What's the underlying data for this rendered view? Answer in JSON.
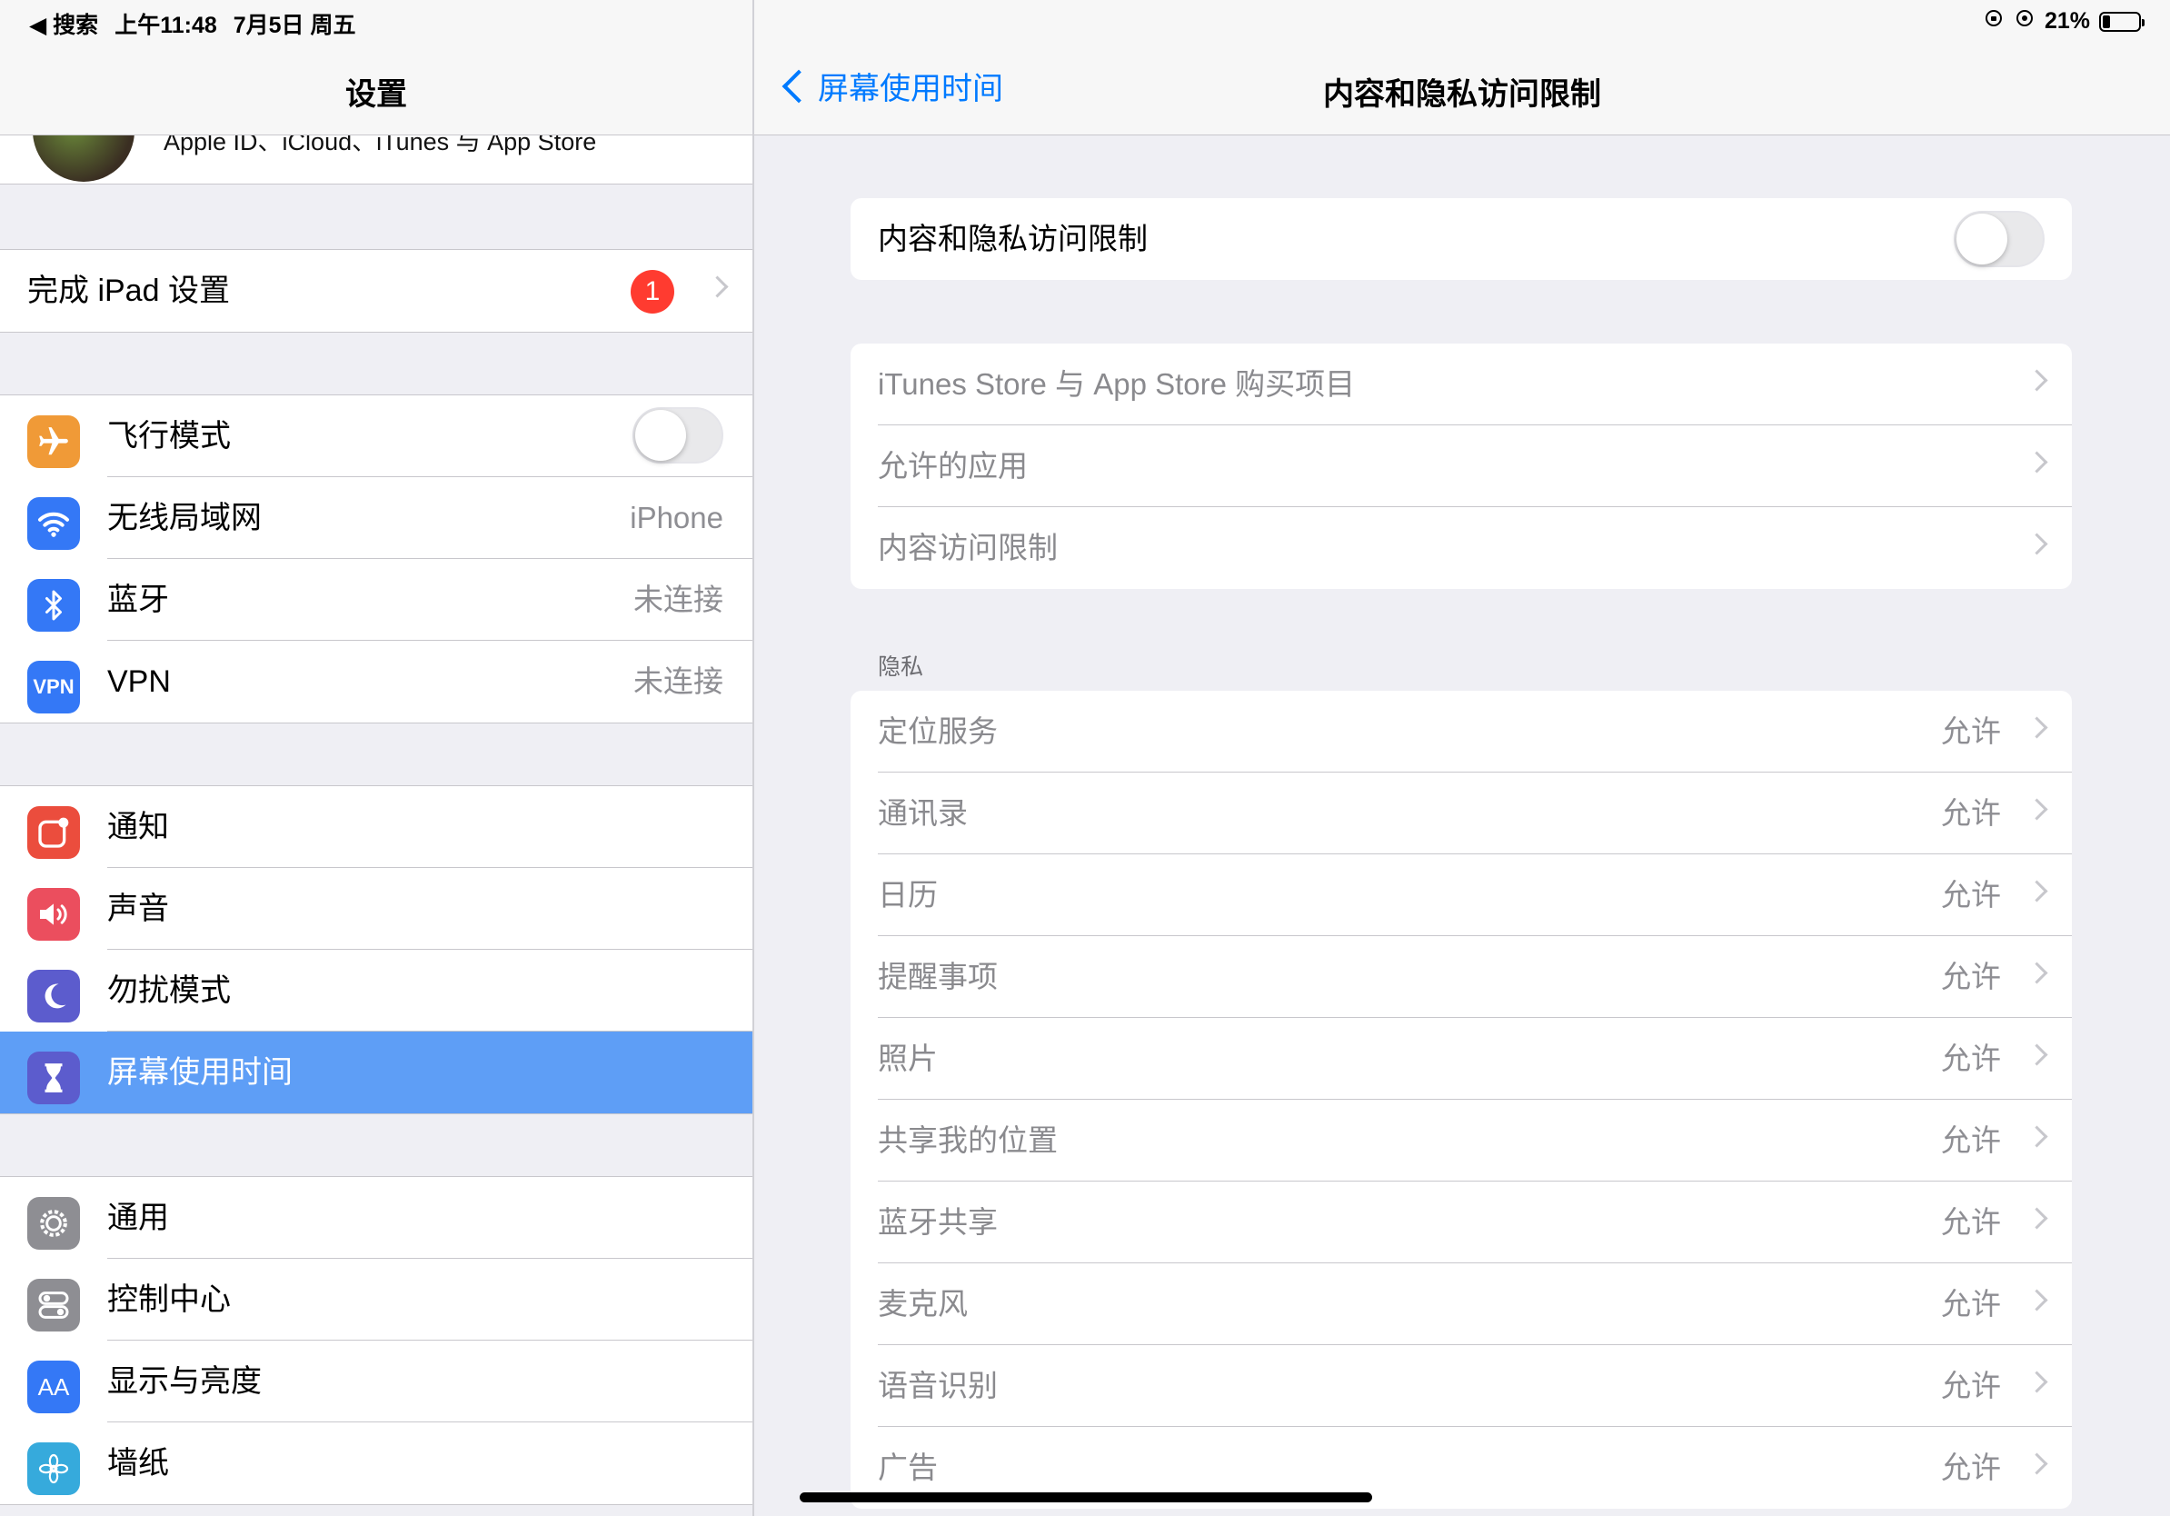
{
  "status_bar": {
    "back_app": "◀ 搜索",
    "time": "上午11:48",
    "date": "7月5日 周五",
    "icons": [
      "orientation-lock-icon",
      "screen-mirroring-icon"
    ],
    "battery_text": "21%",
    "battery_level": 0.21
  },
  "left": {
    "title": "设置",
    "profile_subtitle": "Apple ID、iCloud、iTunes 与 App Store",
    "setup": {
      "label": "完成 iPad 设置",
      "badge": "1"
    },
    "connectivity": [
      {
        "label": "飞行模式",
        "icon": "airplane-icon",
        "color": "#f09a37",
        "toggle": false
      },
      {
        "label": "无线局域网",
        "icon": "wifi-icon",
        "color": "#3478f6",
        "value": "iPhone"
      },
      {
        "label": "蓝牙",
        "icon": "bluetooth-icon",
        "color": "#3478f6",
        "value": "未连接"
      },
      {
        "label": "VPN",
        "icon": "vpn-icon",
        "color": "#3478f6",
        "value": "未连接",
        "icon_text": "VPN"
      }
    ],
    "alerts": [
      {
        "label": "通知",
        "icon": "notifications-icon",
        "color": "#eb4d3d"
      },
      {
        "label": "声音",
        "icon": "sound-icon",
        "color": "#eb4e5e"
      },
      {
        "label": "勿扰模式",
        "icon": "moon-icon",
        "color": "#5c5ccd"
      },
      {
        "label": "屏幕使用时间",
        "icon": "hourglass-icon",
        "color": "#5c5ccd",
        "selected": true
      }
    ],
    "general": [
      {
        "label": "通用",
        "icon": "gear-icon",
        "color": "#8e8e93"
      },
      {
        "label": "控制中心",
        "icon": "control-center-icon",
        "color": "#8e8e93"
      },
      {
        "label": "显示与亮度",
        "icon": "display-icon",
        "color": "#3478f6",
        "icon_text": "AA"
      },
      {
        "label": "墙纸",
        "icon": "wallpaper-icon",
        "color": "#36aadc"
      }
    ]
  },
  "right": {
    "back_label": "屏幕使用时间",
    "title": "内容和隐私访问限制",
    "main_toggle": {
      "label": "内容和隐私访问限制",
      "on": false
    },
    "store_rows": [
      {
        "label": "iTunes Store 与 App Store 购买项目"
      },
      {
        "label": "允许的应用"
      },
      {
        "label": "内容访问限制"
      }
    ],
    "privacy_header": "隐私",
    "privacy_rows": [
      {
        "label": "定位服务",
        "value": "允许"
      },
      {
        "label": "通讯录",
        "value": "允许"
      },
      {
        "label": "日历",
        "value": "允许"
      },
      {
        "label": "提醒事项",
        "value": "允许"
      },
      {
        "label": "照片",
        "value": "允许"
      },
      {
        "label": "共享我的位置",
        "value": "允许"
      },
      {
        "label": "蓝牙共享",
        "value": "允许"
      },
      {
        "label": "麦克风",
        "value": "允许"
      },
      {
        "label": "语音识别",
        "value": "允许"
      },
      {
        "label": "广告",
        "value": "允许"
      }
    ]
  }
}
